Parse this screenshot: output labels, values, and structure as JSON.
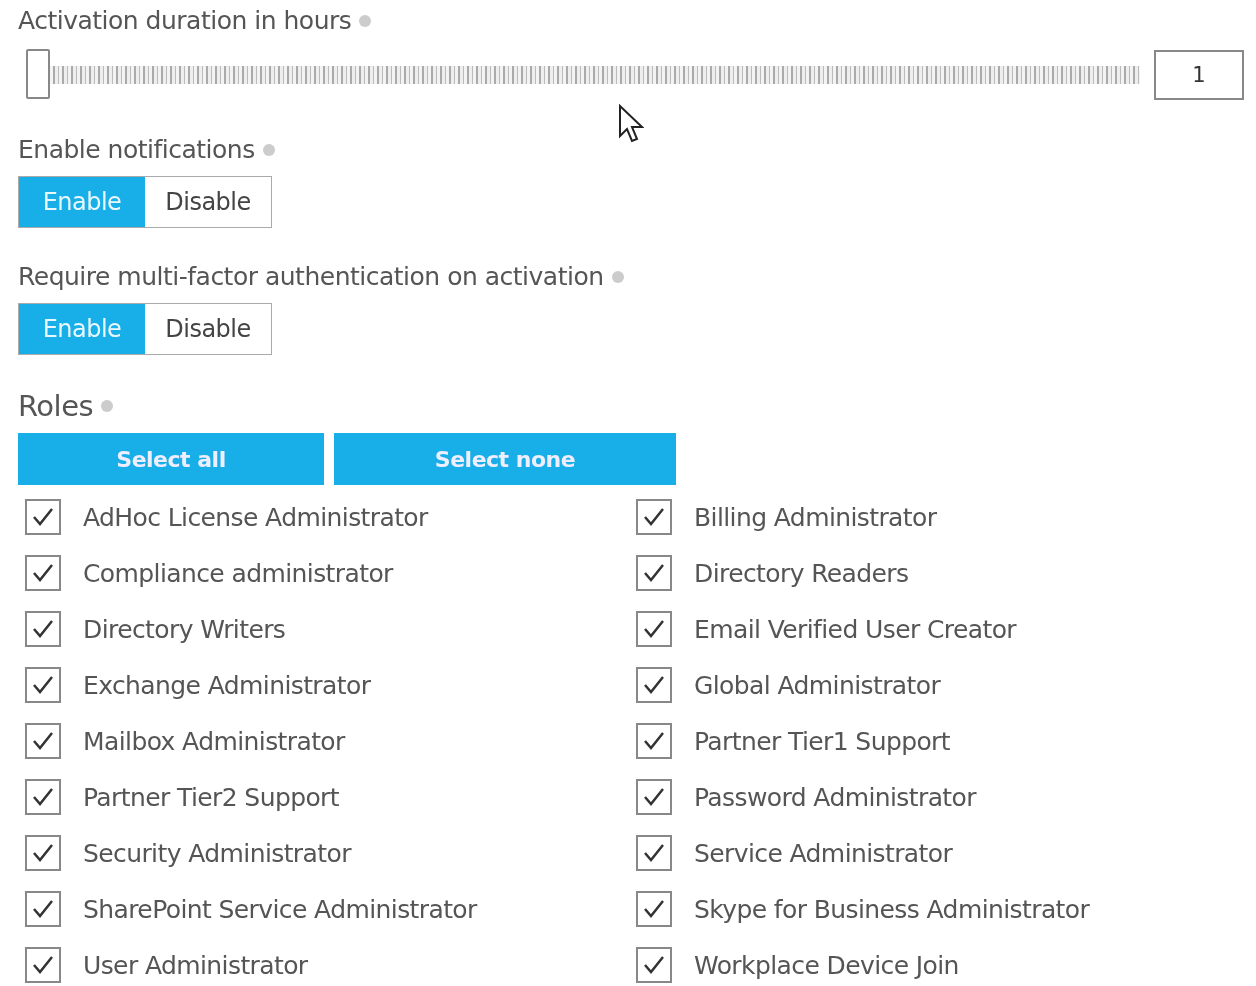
{
  "duration": {
    "label": "Activation duration in hours",
    "level": 0,
    "value": "1"
  },
  "notifications": {
    "label": "Enable notifications",
    "options": [
      {
        "label": "Enable",
        "selected": true
      },
      {
        "label": "Disable",
        "selected": false
      }
    ]
  },
  "mfa": {
    "label": "Require multi-factor authentication on activation",
    "options": [
      {
        "label": "Enable",
        "selected": true
      },
      {
        "label": "Disable",
        "selected": false
      }
    ]
  },
  "roles": {
    "label": "Roles",
    "buttons": [
      "Select all",
      "Select none"
    ],
    "items": [
      {
        "label": "AdHoc License Administrator",
        "checked": true
      },
      {
        "label": "Billing Administrator",
        "checked": true
      },
      {
        "label": "Compliance administrator",
        "checked": true
      },
      {
        "label": "Directory Readers",
        "checked": true
      },
      {
        "label": "Directory Writers",
        "checked": true
      },
      {
        "label": "Email Verified User Creator",
        "checked": true
      },
      {
        "label": "Exchange Administrator",
        "checked": true
      },
      {
        "label": "Global Administrator",
        "checked": true
      },
      {
        "label": "Mailbox Administrator",
        "checked": true
      },
      {
        "label": "Partner Tier1 Support",
        "checked": true
      },
      {
        "label": "Partner Tier2 Support",
        "checked": true
      },
      {
        "label": "Password Administrator",
        "checked": true
      },
      {
        "label": "Security Administrator",
        "checked": true
      },
      {
        "label": "Service Administrator",
        "checked": true
      },
      {
        "label": "SharePoint Service Administrator",
        "checked": true
      },
      {
        "label": "Skype for Business Administrator",
        "checked": true
      },
      {
        "label": "User Administrator",
        "checked": true
      },
      {
        "label": "Workplace Device Join",
        "checked": true
      }
    ]
  }
}
